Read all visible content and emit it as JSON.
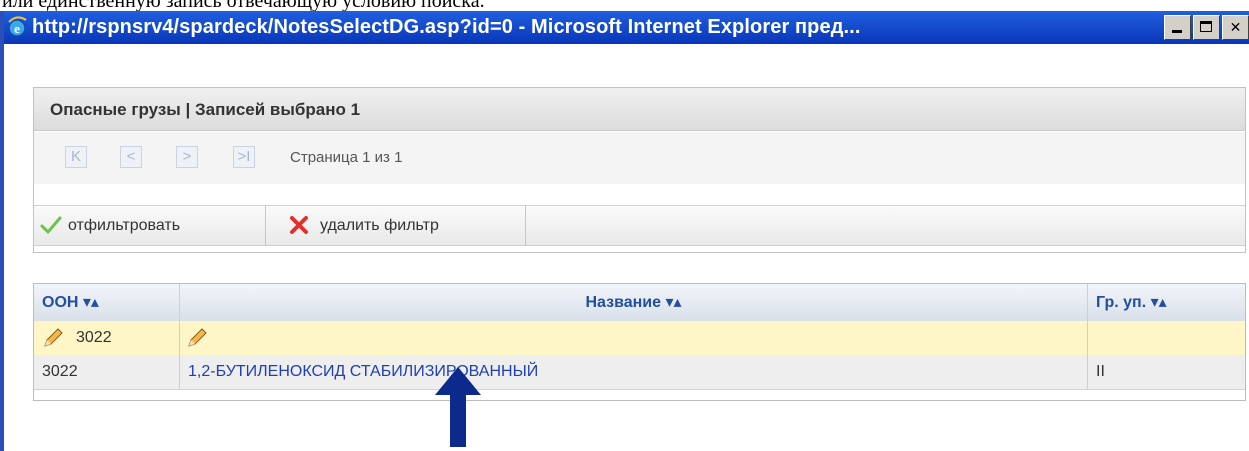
{
  "window": {
    "title": "http://rspnsrv4/spardeck/NotesSelectDG.asp?id=0 - Microsoft Internet Explorer пред...",
    "background_text_cut": "или единственную запись отвечающую условию поиска."
  },
  "panel": {
    "header": "Опасные грузы | Записей выбрано 1",
    "pager": {
      "label": "Страница 1 из 1",
      "first": "K",
      "prev": "<",
      "next": ">",
      "last": ">I"
    },
    "filter": {
      "apply_label": "отфильтровать",
      "clear_label": "удалить фильтр"
    }
  },
  "grid": {
    "columns": [
      "ООН ▾▴",
      "Название ▾▴",
      "Гр. уп. ▾▴"
    ],
    "filter_values": [
      "3022",
      "",
      ""
    ],
    "rows": [
      [
        "3022",
        "1,2-БУТИЛЕНОКСИД СТАБИЛИЗИРОВАННЫЙ",
        "II"
      ]
    ]
  },
  "colors": {
    "titlebar": "#0a36b8",
    "link": "#1f3fb3",
    "filter_row": "#fff6c8",
    "arrow": "#0c2a8c"
  }
}
